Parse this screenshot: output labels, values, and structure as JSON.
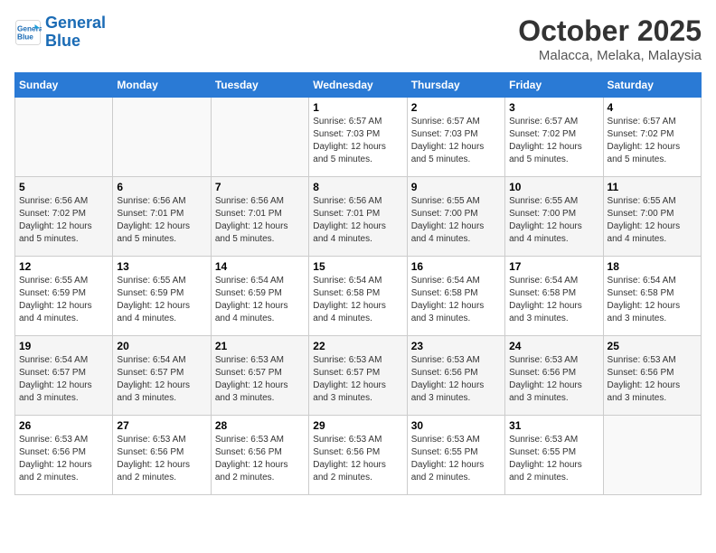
{
  "header": {
    "logo_line1": "General",
    "logo_line2": "Blue",
    "month": "October 2025",
    "location": "Malacca, Melaka, Malaysia"
  },
  "weekdays": [
    "Sunday",
    "Monday",
    "Tuesday",
    "Wednesday",
    "Thursday",
    "Friday",
    "Saturday"
  ],
  "weeks": [
    [
      {
        "day": "",
        "info": ""
      },
      {
        "day": "",
        "info": ""
      },
      {
        "day": "",
        "info": ""
      },
      {
        "day": "1",
        "info": "Sunrise: 6:57 AM\nSunset: 7:03 PM\nDaylight: 12 hours\nand 5 minutes."
      },
      {
        "day": "2",
        "info": "Sunrise: 6:57 AM\nSunset: 7:03 PM\nDaylight: 12 hours\nand 5 minutes."
      },
      {
        "day": "3",
        "info": "Sunrise: 6:57 AM\nSunset: 7:02 PM\nDaylight: 12 hours\nand 5 minutes."
      },
      {
        "day": "4",
        "info": "Sunrise: 6:57 AM\nSunset: 7:02 PM\nDaylight: 12 hours\nand 5 minutes."
      }
    ],
    [
      {
        "day": "5",
        "info": "Sunrise: 6:56 AM\nSunset: 7:02 PM\nDaylight: 12 hours\nand 5 minutes."
      },
      {
        "day": "6",
        "info": "Sunrise: 6:56 AM\nSunset: 7:01 PM\nDaylight: 12 hours\nand 5 minutes."
      },
      {
        "day": "7",
        "info": "Sunrise: 6:56 AM\nSunset: 7:01 PM\nDaylight: 12 hours\nand 5 minutes."
      },
      {
        "day": "8",
        "info": "Sunrise: 6:56 AM\nSunset: 7:01 PM\nDaylight: 12 hours\nand 4 minutes."
      },
      {
        "day": "9",
        "info": "Sunrise: 6:55 AM\nSunset: 7:00 PM\nDaylight: 12 hours\nand 4 minutes."
      },
      {
        "day": "10",
        "info": "Sunrise: 6:55 AM\nSunset: 7:00 PM\nDaylight: 12 hours\nand 4 minutes."
      },
      {
        "day": "11",
        "info": "Sunrise: 6:55 AM\nSunset: 7:00 PM\nDaylight: 12 hours\nand 4 minutes."
      }
    ],
    [
      {
        "day": "12",
        "info": "Sunrise: 6:55 AM\nSunset: 6:59 PM\nDaylight: 12 hours\nand 4 minutes."
      },
      {
        "day": "13",
        "info": "Sunrise: 6:55 AM\nSunset: 6:59 PM\nDaylight: 12 hours\nand 4 minutes."
      },
      {
        "day": "14",
        "info": "Sunrise: 6:54 AM\nSunset: 6:59 PM\nDaylight: 12 hours\nand 4 minutes."
      },
      {
        "day": "15",
        "info": "Sunrise: 6:54 AM\nSunset: 6:58 PM\nDaylight: 12 hours\nand 4 minutes."
      },
      {
        "day": "16",
        "info": "Sunrise: 6:54 AM\nSunset: 6:58 PM\nDaylight: 12 hours\nand 3 minutes."
      },
      {
        "day": "17",
        "info": "Sunrise: 6:54 AM\nSunset: 6:58 PM\nDaylight: 12 hours\nand 3 minutes."
      },
      {
        "day": "18",
        "info": "Sunrise: 6:54 AM\nSunset: 6:58 PM\nDaylight: 12 hours\nand 3 minutes."
      }
    ],
    [
      {
        "day": "19",
        "info": "Sunrise: 6:54 AM\nSunset: 6:57 PM\nDaylight: 12 hours\nand 3 minutes."
      },
      {
        "day": "20",
        "info": "Sunrise: 6:54 AM\nSunset: 6:57 PM\nDaylight: 12 hours\nand 3 minutes."
      },
      {
        "day": "21",
        "info": "Sunrise: 6:53 AM\nSunset: 6:57 PM\nDaylight: 12 hours\nand 3 minutes."
      },
      {
        "day": "22",
        "info": "Sunrise: 6:53 AM\nSunset: 6:57 PM\nDaylight: 12 hours\nand 3 minutes."
      },
      {
        "day": "23",
        "info": "Sunrise: 6:53 AM\nSunset: 6:56 PM\nDaylight: 12 hours\nand 3 minutes."
      },
      {
        "day": "24",
        "info": "Sunrise: 6:53 AM\nSunset: 6:56 PM\nDaylight: 12 hours\nand 3 minutes."
      },
      {
        "day": "25",
        "info": "Sunrise: 6:53 AM\nSunset: 6:56 PM\nDaylight: 12 hours\nand 3 minutes."
      }
    ],
    [
      {
        "day": "26",
        "info": "Sunrise: 6:53 AM\nSunset: 6:56 PM\nDaylight: 12 hours\nand 2 minutes."
      },
      {
        "day": "27",
        "info": "Sunrise: 6:53 AM\nSunset: 6:56 PM\nDaylight: 12 hours\nand 2 minutes."
      },
      {
        "day": "28",
        "info": "Sunrise: 6:53 AM\nSunset: 6:56 PM\nDaylight: 12 hours\nand 2 minutes."
      },
      {
        "day": "29",
        "info": "Sunrise: 6:53 AM\nSunset: 6:56 PM\nDaylight: 12 hours\nand 2 minutes."
      },
      {
        "day": "30",
        "info": "Sunrise: 6:53 AM\nSunset: 6:55 PM\nDaylight: 12 hours\nand 2 minutes."
      },
      {
        "day": "31",
        "info": "Sunrise: 6:53 AM\nSunset: 6:55 PM\nDaylight: 12 hours\nand 2 minutes."
      },
      {
        "day": "",
        "info": ""
      }
    ]
  ]
}
